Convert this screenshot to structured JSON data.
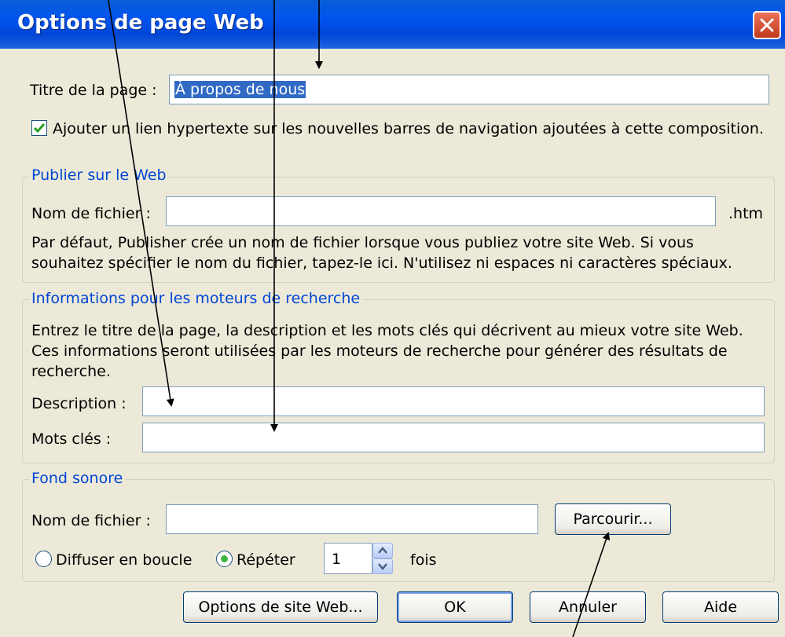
{
  "window": {
    "title": "Options de page Web"
  },
  "page_title": {
    "label": "Titre de la page :",
    "value": "À propos de nous"
  },
  "nav_checkbox": {
    "checked": true,
    "label": "Ajouter un lien hypertexte sur les nouvelles barres de navigation ajoutées à cette composition."
  },
  "publish": {
    "title": "Publier sur le Web",
    "filename_label": "Nom de fichier :",
    "filename_value": "",
    "extension": ".htm",
    "help_line1": "Par défaut, Publisher crée un nom de fichier lorsque vous publiez votre site Web. Si vous",
    "help_line2": "souhaitez spécifier le nom du fichier, tapez-le ici. N'utilisez ni espaces ni caractères spéciaux."
  },
  "search": {
    "title": "Informations pour les moteurs de recherche",
    "help_line1": "Entrez le titre de la page, la description et les mots clés qui décrivent au mieux votre site Web.",
    "help_line2": "Ces informations seront utilisées par les moteurs de recherche pour générer des résultats de",
    "help_line3": "recherche.",
    "description_label": "Description :",
    "description_value": "",
    "keywords_label": "Mots clés :",
    "keywords_value": ""
  },
  "sound": {
    "title": "Fond sonore",
    "filename_label": "Nom de fichier :",
    "filename_value": "",
    "browse_label": "Parcourir...",
    "loop_label": "Diffuser en boucle",
    "repeat_label": "Répéter",
    "repeat_selected": true,
    "repeat_count": "1",
    "times_label": "fois"
  },
  "footer": {
    "site_options_label": "Options de site Web...",
    "ok_label": "OK",
    "cancel_label": "Annuler",
    "help_label": "Aide"
  },
  "colors": {
    "titlebar": "#0053ee",
    "group_title": "#0046d5",
    "selection": "#316ac5"
  }
}
